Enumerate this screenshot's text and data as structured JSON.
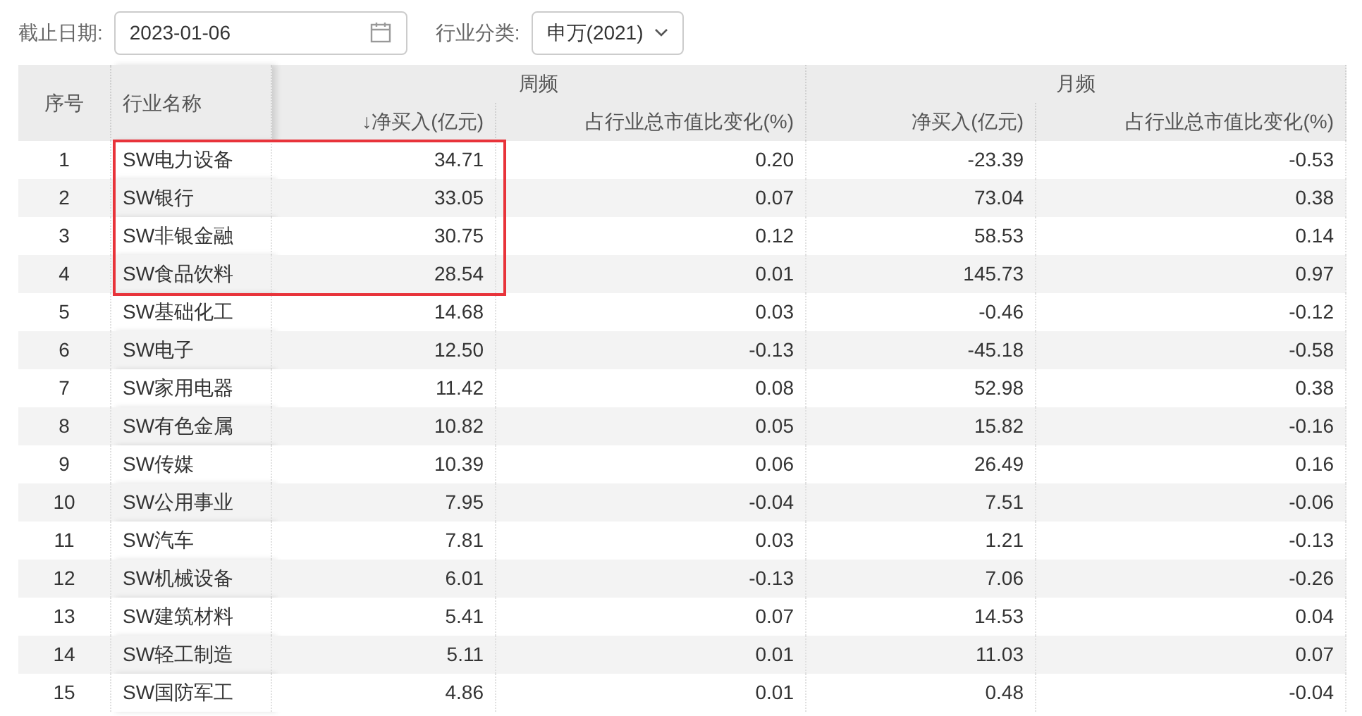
{
  "filters": {
    "date_label": "截止日期:",
    "date_value": "2023-01-06",
    "category_label": "行业分类:",
    "category_value": "申万(2021)"
  },
  "table": {
    "columns": {
      "index": "序号",
      "name": "行业名称",
      "weekly_group": "周频",
      "monthly_group": "月频",
      "weekly_net": "净买入(亿元)",
      "weekly_net_sort": "↓",
      "weekly_pct": "占行业总市值比变化(%)",
      "monthly_net": "净买入(亿元)",
      "monthly_pct": "占行业总市值比变化(%)"
    },
    "rows": [
      {
        "index": "1",
        "name": "SW电力设备",
        "weekly_net": "34.71",
        "weekly_pct": "0.20",
        "monthly_net": "-23.39",
        "monthly_pct": "-0.53",
        "highlighted": true
      },
      {
        "index": "2",
        "name": "SW银行",
        "weekly_net": "33.05",
        "weekly_pct": "0.07",
        "monthly_net": "73.04",
        "monthly_pct": "0.38",
        "highlighted": true
      },
      {
        "index": "3",
        "name": "SW非银金融",
        "weekly_net": "30.75",
        "weekly_pct": "0.12",
        "monthly_net": "58.53",
        "monthly_pct": "0.14",
        "highlighted": true
      },
      {
        "index": "4",
        "name": "SW食品饮料",
        "weekly_net": "28.54",
        "weekly_pct": "0.01",
        "monthly_net": "145.73",
        "monthly_pct": "0.97",
        "highlighted": true
      },
      {
        "index": "5",
        "name": "SW基础化工",
        "weekly_net": "14.68",
        "weekly_pct": "0.03",
        "monthly_net": "-0.46",
        "monthly_pct": "-0.12",
        "highlighted": false
      },
      {
        "index": "6",
        "name": "SW电子",
        "weekly_net": "12.50",
        "weekly_pct": "-0.13",
        "monthly_net": "-45.18",
        "monthly_pct": "-0.58",
        "highlighted": false
      },
      {
        "index": "7",
        "name": "SW家用电器",
        "weekly_net": "11.42",
        "weekly_pct": "0.08",
        "monthly_net": "52.98",
        "monthly_pct": "0.38",
        "highlighted": false
      },
      {
        "index": "8",
        "name": "SW有色金属",
        "weekly_net": "10.82",
        "weekly_pct": "0.05",
        "monthly_net": "15.82",
        "monthly_pct": "-0.16",
        "highlighted": false
      },
      {
        "index": "9",
        "name": "SW传媒",
        "weekly_net": "10.39",
        "weekly_pct": "0.06",
        "monthly_net": "26.49",
        "monthly_pct": "0.16",
        "highlighted": false
      },
      {
        "index": "10",
        "name": "SW公用事业",
        "weekly_net": "7.95",
        "weekly_pct": "-0.04",
        "monthly_net": "7.51",
        "monthly_pct": "-0.06",
        "highlighted": false
      },
      {
        "index": "11",
        "name": "SW汽车",
        "weekly_net": "7.81",
        "weekly_pct": "0.03",
        "monthly_net": "1.21",
        "monthly_pct": "-0.13",
        "highlighted": false
      },
      {
        "index": "12",
        "name": "SW机械设备",
        "weekly_net": "6.01",
        "weekly_pct": "-0.13",
        "monthly_net": "7.06",
        "monthly_pct": "-0.26",
        "highlighted": false
      },
      {
        "index": "13",
        "name": "SW建筑材料",
        "weekly_net": "5.41",
        "weekly_pct": "0.07",
        "monthly_net": "14.53",
        "monthly_pct": "0.04",
        "highlighted": false
      },
      {
        "index": "14",
        "name": "SW轻工制造",
        "weekly_net": "5.11",
        "weekly_pct": "0.01",
        "monthly_net": "11.03",
        "monthly_pct": "0.07",
        "highlighted": false
      },
      {
        "index": "15",
        "name": "SW国防军工",
        "weekly_net": "4.86",
        "weekly_pct": "0.01",
        "monthly_net": "0.48",
        "monthly_pct": "-0.04",
        "highlighted": false
      }
    ]
  }
}
